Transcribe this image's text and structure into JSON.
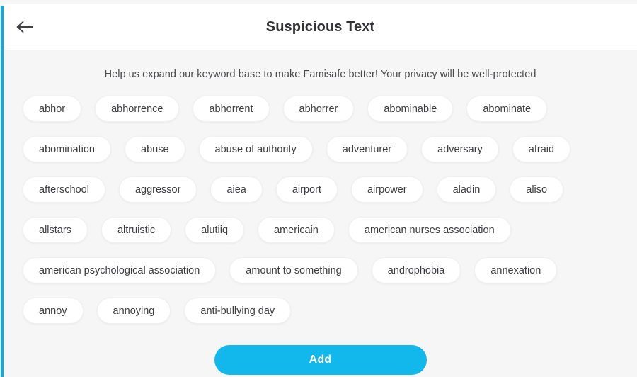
{
  "header": {
    "back_icon": "arrow-left-icon",
    "title": "Suspicious Text"
  },
  "main": {
    "subtitle": "Help us expand our keyword base to make Famisafe better! Your privacy will be well-protected",
    "keywords": [
      "abhor",
      "abhorrence",
      "abhorrent",
      "abhorrer",
      "abominable",
      "abominate",
      "abomination",
      "abuse",
      "abuse of authority",
      "adventurer",
      "adversary",
      "afraid",
      "afterschool",
      "aggressor",
      "aiea",
      "airport",
      "airpower",
      "aladin",
      "aliso",
      "allstars",
      "altruistic",
      "alutiiq",
      "americain",
      "american nurses association",
      "american psychological association",
      "amount to something",
      "androphobia",
      "annexation",
      "annoy",
      "annoying",
      "anti-bullying day"
    ]
  },
  "footer": {
    "add_label": "Add"
  },
  "colors": {
    "accent": "#12b7ec",
    "accent_strip": "#13a9e0",
    "page_background": "#f6f6f7",
    "header_background": "#ffffff",
    "chip_background": "#ffffff",
    "text": "#3a3a3c",
    "title_text": "#333336"
  }
}
